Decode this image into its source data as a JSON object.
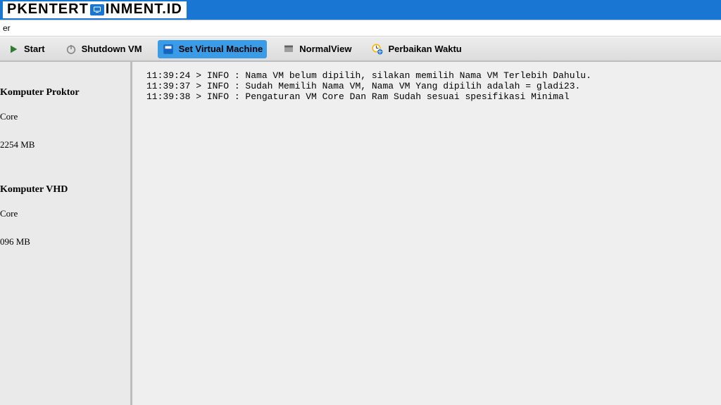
{
  "brand": {
    "left": "PKENTERT",
    "right": "INMENT.ID",
    "badge_glyph": "⬚"
  },
  "filter": {
    "placeholder": "",
    "value": "er"
  },
  "toolbar": {
    "start": "Start",
    "shutdown": "Shutdown VM",
    "setvm": "Set Virtual Machine",
    "normal": "NormalView",
    "perbaikan": "Perbaikan Waktu"
  },
  "sidebar": {
    "group1": {
      "title": "Komputer Proktor",
      "core": "Core",
      "ram": "2254 MB"
    },
    "group2": {
      "title": "Komputer VHD",
      "core": "Core",
      "ram": "096 MB"
    }
  },
  "log": [
    "11:39:24 > INFO : Nama VM belum dipilih, silakan memilih Nama VM Terlebih Dahulu.",
    "11:39:37 > INFO : Sudah Memilih Nama VM, Nama VM Yang dipilih adalah = gladi23.",
    "11:39:38 > INFO : Pengaturan VM Core Dan Ram Sudah sesuai spesifikasi Minimal"
  ],
  "colors": {
    "accent": "#1976d2"
  }
}
